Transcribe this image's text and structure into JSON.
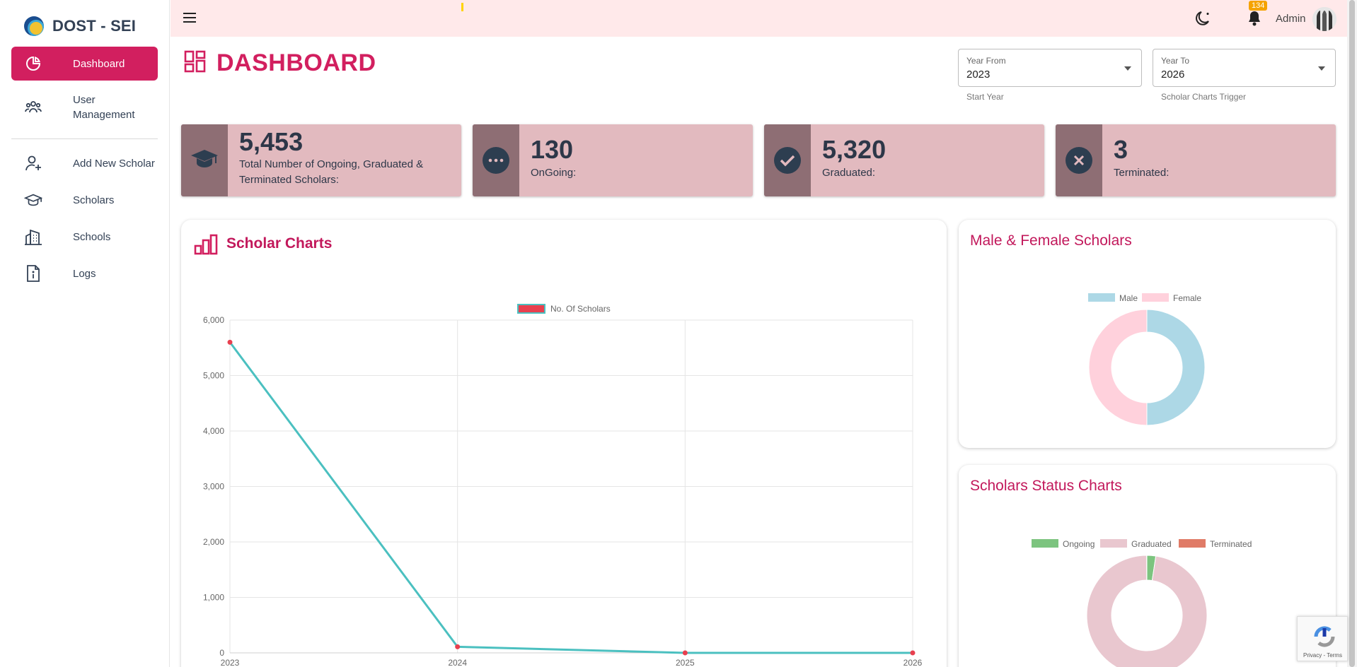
{
  "brand": {
    "name": "DOST - SEI"
  },
  "sidebar": {
    "items": [
      {
        "label": "Dashboard",
        "icon": "dashboard-pie-icon",
        "active": true
      },
      {
        "label": "User\nManagement",
        "icon": "users-icon"
      },
      {
        "label": "Add New Scholar",
        "icon": "user-plus-icon"
      },
      {
        "label": "Scholars",
        "icon": "graduation-cap-icon"
      },
      {
        "label": "Schools",
        "icon": "building-icon"
      },
      {
        "label": "Logs",
        "icon": "document-info-icon"
      }
    ]
  },
  "topbar": {
    "notification_count": "134",
    "user_name": "Admin"
  },
  "page": {
    "title": "DASHBOARD"
  },
  "filters": {
    "year_from": {
      "label": "Year From",
      "value": "2023",
      "helper": "Start Year"
    },
    "year_to": {
      "label": "Year To",
      "value": "2026",
      "helper": "Scholar Charts Trigger"
    }
  },
  "stats": [
    {
      "value": "5,453",
      "label": "Total Number of Ongoing, Graduated & Terminated Scholars:",
      "icon": "graduation-cap-icon"
    },
    {
      "value": "130",
      "label": "OnGoing:",
      "icon": "more-dots-icon"
    },
    {
      "value": "5,320",
      "label": "Graduated:",
      "icon": "check-icon"
    },
    {
      "value": "3",
      "label": "Terminated:",
      "icon": "x-mark-icon"
    }
  ],
  "cards": {
    "scholar_chart": {
      "title": "Scholar Charts"
    },
    "gender_chart": {
      "title": "Male & Female Scholars"
    },
    "status_chart": {
      "title": "Scholars Status Charts"
    }
  },
  "recaptcha": {
    "text": "Privacy - Terms"
  },
  "colors": {
    "accent": "#d21f5f",
    "line": "#4bc0c0",
    "male": "#add8e6",
    "female": "#ffd1dc",
    "ongoing": "#7cc47f",
    "graduated": "#e9c7cf",
    "terminated": "#e07b67"
  },
  "chart_data": [
    {
      "type": "line",
      "legend": [
        "No. Of Scholars"
      ],
      "x": [
        "2023",
        "2024",
        "2025",
        "2026"
      ],
      "series": [
        {
          "name": "No. Of Scholars",
          "values": [
            5600,
            110,
            0,
            0
          ]
        }
      ],
      "ylim": [
        0,
        6000
      ],
      "yticks": [
        "0",
        "1,000",
        "2,000",
        "3,000",
        "4,000",
        "5,000",
        "6,000"
      ],
      "grid": true,
      "legend_position": "top"
    },
    {
      "type": "pie",
      "donut": true,
      "categories": [
        "Male",
        "Female"
      ],
      "values": [
        50,
        50
      ],
      "legend_position": "top"
    },
    {
      "type": "pie",
      "donut": true,
      "categories": [
        "Ongoing",
        "Graduated",
        "Terminated"
      ],
      "values": [
        130,
        5320,
        3
      ],
      "legend_position": "top"
    }
  ]
}
